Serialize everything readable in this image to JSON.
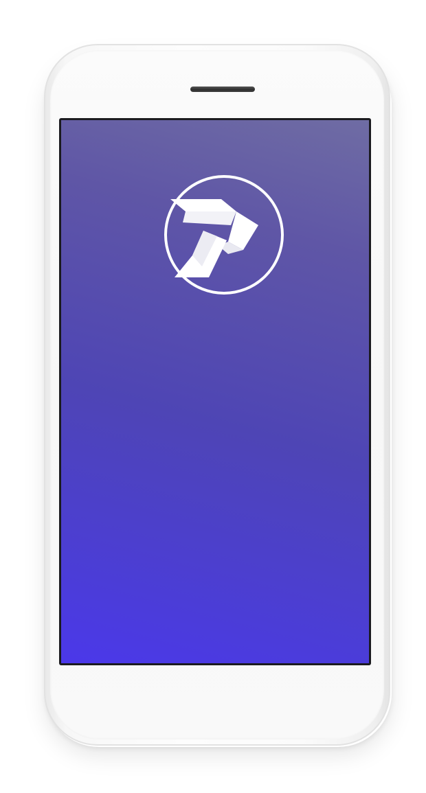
{
  "device": {
    "type": "smartphone",
    "color": "#f8f8f8"
  },
  "screen": {
    "gradient_top": "#6f6ca4",
    "gradient_bottom": "#4b38ea",
    "logo": {
      "icon": "p-monogram-logo-icon",
      "color": "#ffffff"
    }
  }
}
